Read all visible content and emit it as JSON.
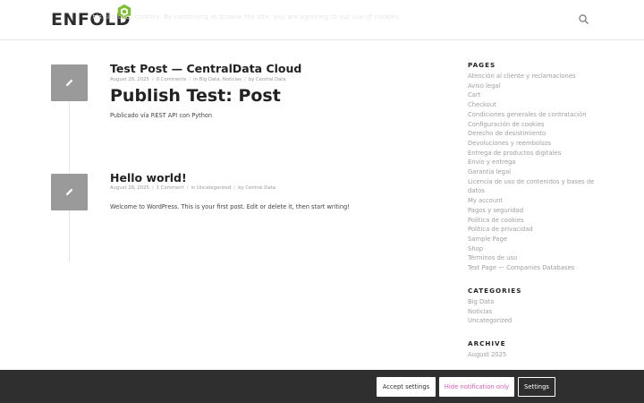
{
  "header": {
    "logo_text": "ENFOLD",
    "accent": "#7bbf2a"
  },
  "posts": [
    {
      "title": "Test Post — CentralData Cloud",
      "date": "August 28, 2025",
      "comments": "0 Comments",
      "in_label": "in",
      "categories": "Big Data, Noticias",
      "by_label": "by",
      "author": "Central Data",
      "heading": "Publish Test: Post",
      "body": "Publicado vía REST API con Python"
    },
    {
      "title": "Hello world!",
      "date": "August 28, 2025",
      "comments": "1 Comment",
      "in_label": "in",
      "categories": "Uncategorized",
      "by_label": "by",
      "author": "Central Data",
      "body": "Welcome to WordPress. This is your first post. Edit or delete it, then start writing!"
    }
  ],
  "sidebar": {
    "pages_heading": "PAGES",
    "pages": [
      "Atención al cliente y reclamaciones",
      "Aviso legal",
      "Cart",
      "Checkout",
      "Condiciones generales de contratación",
      "Configuración de cookies",
      "Derecho de desistimiento",
      "Devoluciones y reembolsos",
      "Entrega de productos digitales",
      "Envío y entrega",
      "Garantía legal",
      "Licencia de uso de contenidos y bases de",
      "datos",
      "My account",
      "Pagos y seguridad",
      "Política de cookies",
      "Política de privacidad",
      "Sample Page",
      "Shop",
      "Términos de uso",
      "Test Page — Companies Databases"
    ],
    "categories_heading": "CATEGORIES",
    "categories": [
      "Big Data",
      "Noticias",
      "Uncategorized"
    ],
    "archive_heading": "ARCHIVE",
    "archive": [
      "August 2025"
    ]
  },
  "cookie": {
    "text": "This site uses cookies. By continuing to browse the site, you are agreeing to our use of cookies.",
    "accept_label": "Accept settings",
    "hide_label": "Hide notification only",
    "settings_label": "Settings"
  }
}
